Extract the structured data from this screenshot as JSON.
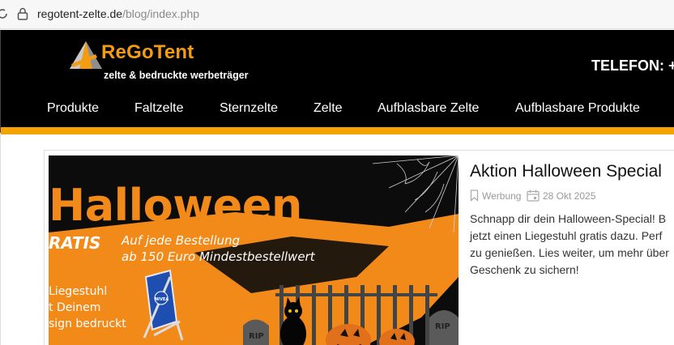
{
  "browser": {
    "url_domain": "regotent-zelte.de",
    "url_path": "/blog/index.php"
  },
  "header": {
    "logo_name": "ReGoTent",
    "logo_tagline": "zelte & bedruckte werbeträger",
    "phone_label": "TELEFON: +",
    "brand_color": "#f39c12"
  },
  "nav": {
    "items": [
      "Produkte",
      "Faltzelte",
      "Sternzelte",
      "Zelte",
      "Aufblasbare Zelte",
      "Aufblasbare Produkte"
    ]
  },
  "post": {
    "image": {
      "headline": "Halloween",
      "gratis": "RATIS",
      "offer_line1": "Auf jede Bestellung",
      "offer_line2": "ab 150 Euro Mindestbestellwert",
      "chair_line1": "Liegestuhl",
      "chair_line2": "t Deinem",
      "chair_line3": "sign bedruckt",
      "chair_brand": "NIVEA",
      "tomb_text": "RIP"
    },
    "title": "Aktion Halloween Special",
    "category": "Werbung",
    "date": "28 Okt 2025",
    "excerpt_lines": [
      "Schnapp dir dein Halloween-Special! B",
      "jetzt einen Liegestuhl gratis dazu. Perf",
      "zu genießen. Lies weiter, um mehr über",
      "Geschenk zu sichern!"
    ]
  },
  "colors": {
    "accent_orange": "#f5a300",
    "header_bg": "#000000"
  }
}
